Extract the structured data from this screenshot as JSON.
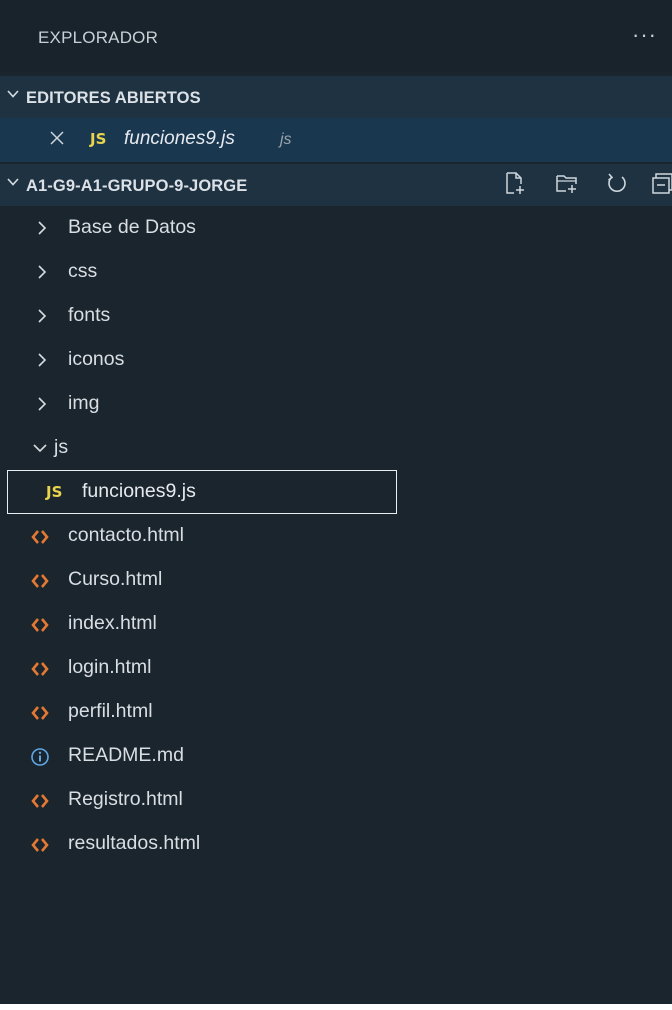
{
  "explorer": {
    "title": "EXPLORADOR",
    "more_glyph": "···"
  },
  "open_editors": {
    "header": "EDITORES ABIERTOS",
    "items": [
      {
        "badge": "JS",
        "name": "funciones9.js",
        "folder": "js"
      }
    ]
  },
  "workspace": {
    "header": "A1-G9-A1-GRUPO-9-JORGE",
    "actions": [
      "new-file-icon",
      "new-folder-icon",
      "refresh-icon",
      "collapse-all-icon"
    ],
    "folders": [
      {
        "name": "Base de Datos",
        "expanded": false
      },
      {
        "name": "css",
        "expanded": false
      },
      {
        "name": "fonts",
        "expanded": false
      },
      {
        "name": "iconos",
        "expanded": false
      },
      {
        "name": "img",
        "expanded": false
      },
      {
        "name": "js",
        "expanded": true
      }
    ],
    "js_children": [
      {
        "badge": "JS",
        "name": "funciones9.js"
      }
    ],
    "files": [
      {
        "name": "contacto.html",
        "icon": "html-icon"
      },
      {
        "name": "Curso.html",
        "icon": "html-icon"
      },
      {
        "name": "index.html",
        "icon": "html-icon"
      },
      {
        "name": "login.html",
        "icon": "html-icon"
      },
      {
        "name": "perfil.html",
        "icon": "html-icon"
      },
      {
        "name": "README.md",
        "icon": "info-icon"
      },
      {
        "name": "Registro.html",
        "icon": "html-icon"
      },
      {
        "name": "resultados.html",
        "icon": "html-icon"
      }
    ]
  },
  "colors": {
    "background": "#1b252d",
    "section_header": "#1e3242",
    "selected_row": "#1a3750",
    "js_badge": "#e8d44d",
    "html_icon": "#e37933",
    "info_icon": "#5fa8e8",
    "text": "#d9dee3"
  }
}
